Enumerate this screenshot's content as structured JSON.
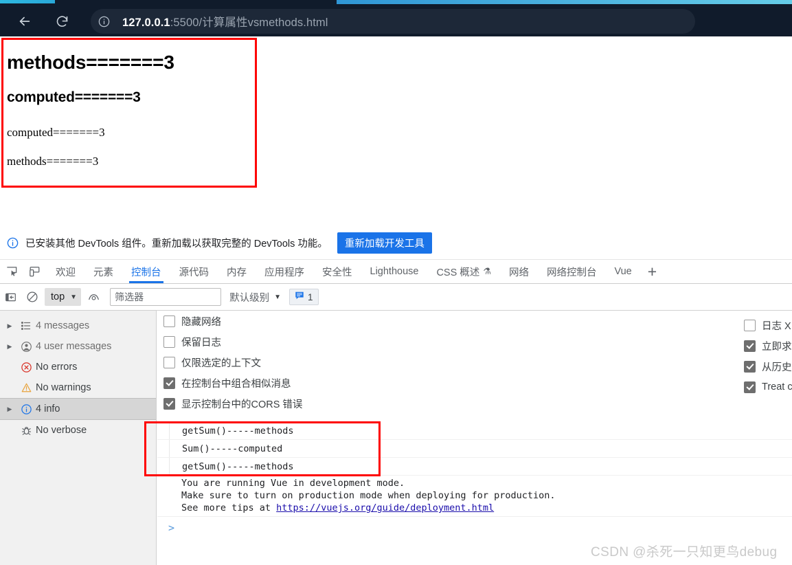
{
  "browser": {
    "back_icon": "back-arrow-icon",
    "reload_icon": "reload-icon",
    "info_icon": "info-circle-icon",
    "url_host": "127.0.0.1",
    "url_rest": ":5500/计算属性vsmethods.html"
  },
  "page_output": {
    "line1": "methods=======3",
    "line2": "computed=======3",
    "line3": "computed=======3",
    "line4": "methods=======3"
  },
  "notification": {
    "icon": "info-circle-icon",
    "text": "已安装其他 DevTools 组件。重新加载以获取完整的 DevTools 功能。",
    "button": "重新加载开发工具"
  },
  "devtools_tabs": {
    "inspect_icon": "inspect-element-icon",
    "device_icon": "device-toolbar-icon",
    "items": [
      {
        "label": "欢迎",
        "active": false
      },
      {
        "label": "元素",
        "active": false
      },
      {
        "label": "控制台",
        "active": true
      },
      {
        "label": "源代码",
        "active": false
      },
      {
        "label": "内存",
        "active": false
      },
      {
        "label": "应用程序",
        "active": false
      },
      {
        "label": "安全性",
        "active": false
      },
      {
        "label": "Lighthouse",
        "active": false
      },
      {
        "label": "CSS 概述",
        "active": false,
        "suffix": "⚗"
      },
      {
        "label": "网络",
        "active": false
      },
      {
        "label": "网络控制台",
        "active": false
      },
      {
        "label": "Vue",
        "active": false
      }
    ],
    "add_tab": "+"
  },
  "console_toolbar": {
    "sidebar_toggle_icon": "sidebar-toggle-icon",
    "clear_icon": "clear-console-icon",
    "context_value": "top",
    "eye_icon": "live-expression-icon",
    "filter_placeholder": "筛选器",
    "filter_value": "",
    "level_label": "默认级别",
    "issues_icon": "issues-icon",
    "issues_count": "1"
  },
  "console_sidebar": [
    {
      "label": "4 messages",
      "icon": "list-icon",
      "expandable": true,
      "selected": false,
      "muted": true
    },
    {
      "label": "4 user messages",
      "icon": "user-icon",
      "expandable": true,
      "selected": false,
      "muted": true
    },
    {
      "label": "No errors",
      "icon": "error-icon",
      "expandable": false,
      "selected": false,
      "muted": false
    },
    {
      "label": "No warnings",
      "icon": "warning-icon",
      "expandable": false,
      "selected": false,
      "muted": false
    },
    {
      "label": "4 info",
      "icon": "info-icon",
      "expandable": true,
      "selected": true,
      "muted": false
    },
    {
      "label": "No verbose",
      "icon": "bug-icon",
      "expandable": false,
      "selected": false,
      "muted": false
    }
  ],
  "console_options_left": [
    {
      "label": "隐藏网络",
      "checked": false
    },
    {
      "label": "保留日志",
      "checked": false
    },
    {
      "label": "仅限选定的上下文",
      "checked": false
    },
    {
      "label": "在控制台中组合相似消息",
      "checked": true
    },
    {
      "label": "显示控制台中的CORS 错误",
      "checked": true
    }
  ],
  "console_options_right": [
    {
      "label": "日志 XI",
      "checked": false
    },
    {
      "label": "立即求",
      "checked": true
    },
    {
      "label": "从历史",
      "checked": true
    },
    {
      "label": "Treat c",
      "checked": true
    }
  ],
  "console_logs": [
    "getSum()-----methods",
    "Sum()-----computed",
    "getSum()-----methods"
  ],
  "vue_message": {
    "line1": "You are running Vue in development mode.",
    "line2": "Make sure to turn on production mode when deploying for production.",
    "line3_prefix": "See more tips at ",
    "link": "https://vuejs.org/guide/deployment.html"
  },
  "prompt": ">",
  "watermark": "CSDN @杀死一只知更鸟debug",
  "colors": {
    "accent_blue": "#1a73e8",
    "annotation_red": "#fe0000",
    "chrome_dark": "#101b2b"
  }
}
